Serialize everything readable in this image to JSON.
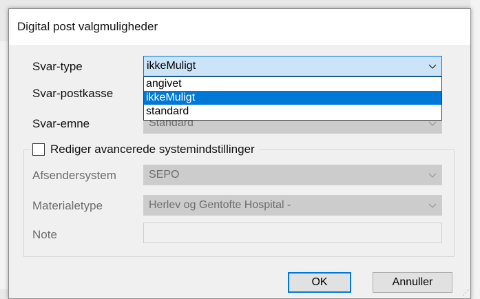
{
  "dialog": {
    "title": "Digital post valgmuligheder"
  },
  "fields": {
    "svar_type": {
      "label": "Svar-type",
      "value": "ikkeMuligt"
    },
    "svar_postkasse": {
      "label": "Svar-postkasse"
    },
    "svar_emne": {
      "label": "Svar-emne",
      "value": "Standard"
    }
  },
  "dropdown": {
    "options": [
      "angivet",
      "ikkeMuligt",
      "standard"
    ],
    "selected": "ikkeMuligt"
  },
  "advanced": {
    "checkbox_label": "Rediger avancerede systemindstillinger",
    "checked": false,
    "afsendersystem": {
      "label": "Afsendersystem",
      "value": "SEPO"
    },
    "materialetype": {
      "label": "Materialetype",
      "value": "Herlev og Gentofte Hospital -"
    },
    "note": {
      "label": "Note",
      "value": ""
    }
  },
  "buttons": {
    "ok": "OK",
    "cancel": "Annuller"
  }
}
